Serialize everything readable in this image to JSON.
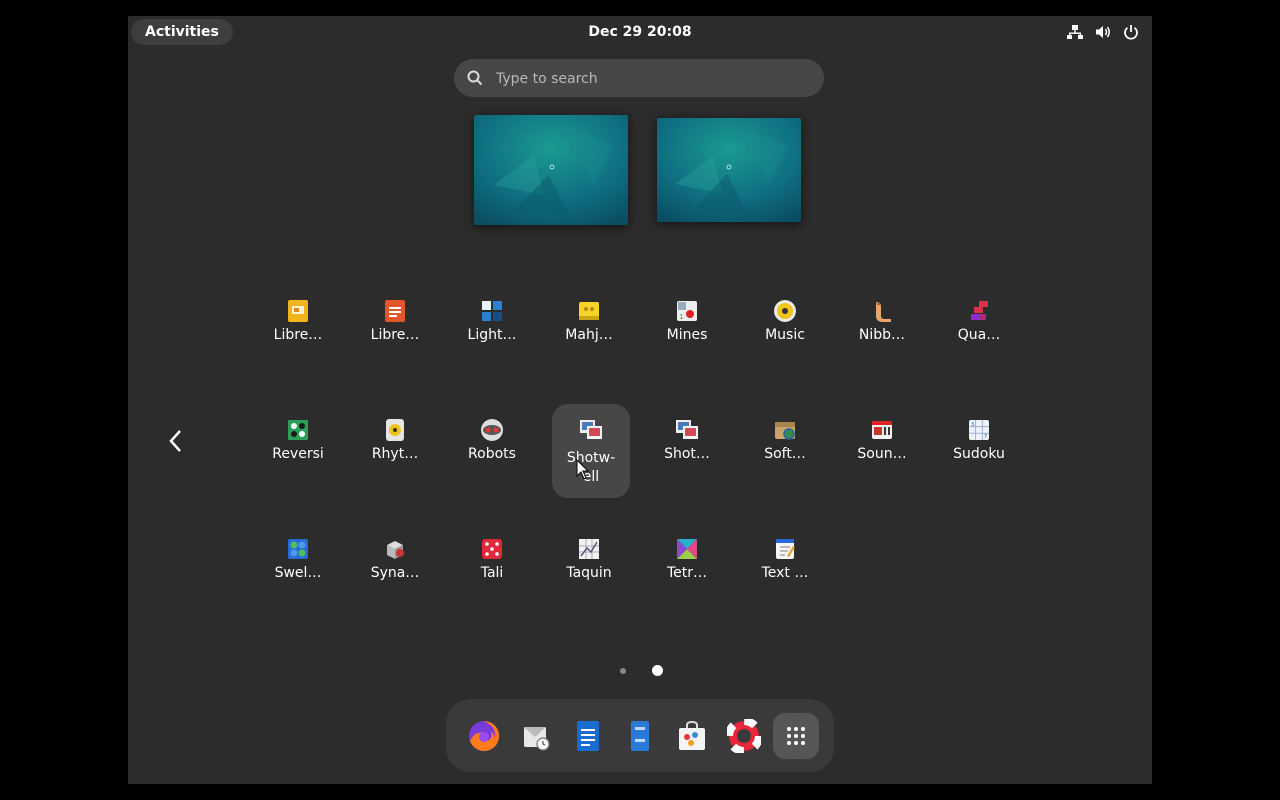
{
  "topbar": {
    "activities_label": "Activities",
    "clock": "Dec 29  20:08",
    "tray_icons": [
      "network-icon",
      "volume-icon",
      "power-icon"
    ]
  },
  "search": {
    "placeholder": "Type to search"
  },
  "app_grid": {
    "rows": [
      [
        "Libre…",
        "Libre…",
        "Light…",
        "Mahj…",
        "Mines",
        "Music",
        "Nibb…",
        "Qua…"
      ],
      [
        "Reversi",
        "Rhyt…",
        "Robots",
        "Shotw-ell",
        "Shot…",
        "Soft…",
        "Soun…",
        "Sudoku"
      ],
      [
        "Swel…",
        "Syna…",
        "Tali",
        "Taquin",
        "Tetr…",
        "Text …"
      ]
    ],
    "page_indicator": {
      "pages": 2,
      "current": 2
    }
  },
  "apps": {
    "libreoffice_impress": "Libre…",
    "libreoffice_writer": "Libre…",
    "lightsoff": "Light…",
    "mahjongg": "Mahj…",
    "mines": "Mines",
    "music": "Music",
    "nibbles": "Nibb…",
    "quadrapassel": "Qua…",
    "reversi": "Reversi",
    "rhythmbox": "Rhyt…",
    "robots": "Robots",
    "shotwell": "Shotw-\nell",
    "shotwell_viewer": "Shot…",
    "software_properties": "Soft…",
    "sound_recorder": "Soun…",
    "sudoku": "Sudoku",
    "swell_foop": "Swel…",
    "synaptic": "Syna…",
    "tali": "Tali",
    "taquin": "Taquin",
    "tetravex": "Tetr…",
    "text_editor": "Text …"
  },
  "dash": {
    "items": [
      "firefox-icon",
      "evolution-icon",
      "libreoffice-writer-icon",
      "files-icon",
      "software-icon",
      "help-icon",
      "show-apps-icon"
    ]
  },
  "colors": {
    "background": "#2c2c2c",
    "panel": "#3a3a3a",
    "search_bg": "#474747",
    "wallpaper_teal": "#0f7a86"
  }
}
